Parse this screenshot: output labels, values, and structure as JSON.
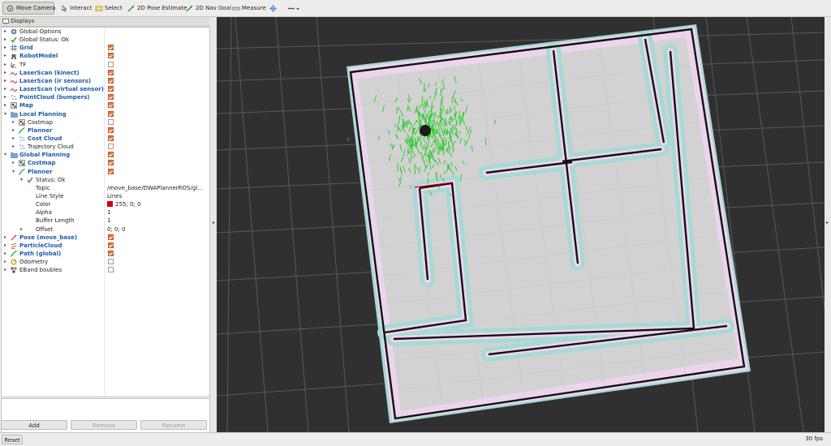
{
  "toolbar": {
    "move_camera": "Move Camera",
    "interact": "Interact",
    "select": "Select",
    "pose_estimate": "2D Pose Estimate",
    "nav_goal": "2D Nav Goal",
    "measure": "Measure"
  },
  "displays": {
    "title": "Displays",
    "rows": [
      {
        "label": "Global Options",
        "icon": "gear-icon",
        "check": null
      },
      {
        "label": "Global Status: Ok",
        "icon": "check-icon",
        "check": null
      },
      {
        "label": "Grid",
        "icon": "grid-icon",
        "check": true,
        "highlight": true
      },
      {
        "label": "RobotModel",
        "icon": "robot-icon",
        "check": true,
        "highlight": true
      },
      {
        "label": "TF",
        "icon": "tf-icon",
        "check": false
      },
      {
        "label": "LaserScan (kinect)",
        "icon": "laserscan-icon",
        "check": true,
        "highlight": true
      },
      {
        "label": "LaserScan (ir sensors)",
        "icon": "laserscan-icon",
        "check": true,
        "highlight": true
      },
      {
        "label": "LaserScan (virtual sensor)",
        "icon": "laserscan-icon",
        "check": true,
        "highlight": true
      },
      {
        "label": "PointCloud (bumpers)",
        "icon": "pointcloud-icon",
        "check": true,
        "highlight": true
      },
      {
        "label": "Map",
        "icon": "map-icon",
        "check": true,
        "highlight": true
      },
      {
        "label": "Local Planning",
        "icon": "folder-icon",
        "check": true,
        "highlight": true,
        "expanded": true
      },
      {
        "label": "Costmap",
        "icon": "map-icon",
        "check": false,
        "indent": 1
      },
      {
        "label": "Planner",
        "icon": "path-icon",
        "check": true,
        "highlight": true,
        "indent": 1
      },
      {
        "label": "Cost Cloud",
        "icon": "pointcloud-icon",
        "check": true,
        "highlight": true,
        "indent": 1
      },
      {
        "label": "Trajectory Cloud",
        "icon": "pointcloud-icon",
        "check": false,
        "indent": 1
      },
      {
        "label": "Global Planning",
        "icon": "folder-icon",
        "check": true,
        "highlight": true,
        "expanded": true
      },
      {
        "label": "Costmap",
        "icon": "map-icon",
        "check": true,
        "highlight": true,
        "indent": 1
      },
      {
        "label": "Planner",
        "icon": "path-icon",
        "check": true,
        "highlight": true,
        "indent": 1,
        "expanded": true
      },
      {
        "label": "Status: Ok",
        "icon": "check-icon",
        "check": null,
        "indent": 2,
        "expanded": true
      },
      {
        "label": "Topic",
        "value": "/move_base/DWAPlannerROS/gl...",
        "indent": 2,
        "noarrow": true
      },
      {
        "label": "Line Style",
        "value": "Lines",
        "indent": 2,
        "noarrow": true
      },
      {
        "label": "Color",
        "value": "255; 0; 0",
        "swatch": "#cc0000",
        "indent": 2,
        "noarrow": true
      },
      {
        "label": "Alpha",
        "value": "1",
        "indent": 2,
        "noarrow": true
      },
      {
        "label": "Buffer Length",
        "value": "1",
        "indent": 2,
        "noarrow": true
      },
      {
        "label": "Offset",
        "value": "0; 0; 0",
        "indent": 2
      },
      {
        "label": "Pose (move_base)",
        "icon": "pose-icon",
        "check": true,
        "highlight": true
      },
      {
        "label": "ParticleCloud",
        "icon": "particle-icon",
        "check": true,
        "highlight": true
      },
      {
        "label": "Path (global)",
        "icon": "path-icon",
        "check": true,
        "highlight": true
      },
      {
        "label": "Odometry",
        "icon": "odometry-icon",
        "check": false
      },
      {
        "label": "EBand boubles",
        "icon": "marker-icon",
        "check": false
      }
    ]
  },
  "buttons": {
    "add": "Add",
    "remove": "Remove",
    "rename": "Rename",
    "reset": "Reset"
  },
  "status": {
    "fps": "30 fps"
  },
  "colors": {
    "accent": "#e2753f",
    "highlight_text": "#1d5aa8",
    "viewport_bg": "#303030",
    "particles": "#22cc22"
  }
}
